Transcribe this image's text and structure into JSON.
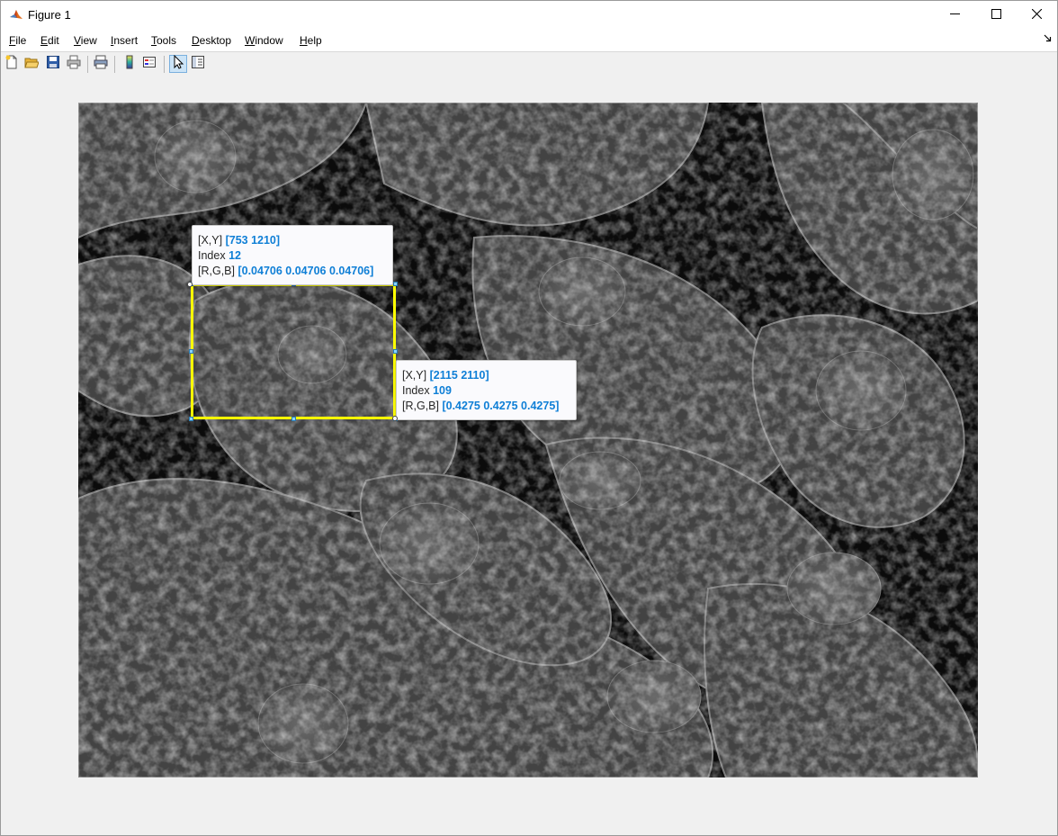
{
  "window": {
    "title": "Figure 1",
    "controls": {
      "minimize": "minimize-icon",
      "maximize": "maximize-icon",
      "close": "close-icon"
    }
  },
  "menu": {
    "items": [
      {
        "label": "File",
        "underline": "F",
        "rest": "ile"
      },
      {
        "label": "Edit",
        "underline": "E",
        "rest": "dit"
      },
      {
        "label": "View",
        "underline": "V",
        "rest": "iew"
      },
      {
        "label": "Insert",
        "underline": "I",
        "rest": "nsert"
      },
      {
        "label": "Tools",
        "underline": "T",
        "rest": "ools"
      },
      {
        "label": "Desktop",
        "underline": "D",
        "rest": "esktop"
      },
      {
        "label": "Window",
        "underline": "W",
        "rest": "indow"
      },
      {
        "label": "Help",
        "underline": "H",
        "rest": "elp"
      }
    ]
  },
  "toolbar": {
    "buttons": [
      "new-figure-icon",
      "open-file-icon",
      "save-icon",
      "print-icon",
      "print-preview-icon",
      "insert-colorbar-icon",
      "insert-legend-icon",
      "edit-plot-pointer-icon",
      "property-inspector-icon"
    ],
    "active": "edit-plot-pointer-icon"
  },
  "image": {
    "description_icon": "microscopy-image"
  },
  "datatips": [
    {
      "xy_label": "[X,Y]",
      "xy_value": "[753 1210]",
      "index_label": "Index",
      "index_value": "12",
      "rgb_label": "[R,G,B]",
      "rgb_value": "[0.04706 0.04706 0.04706]"
    },
    {
      "xy_label": "[X,Y]",
      "xy_value": "[2115 2110]",
      "index_label": "Index",
      "index_value": "109",
      "rgb_label": "[R,G,B]",
      "rgb_value": "[0.4275 0.4275 0.4275]"
    }
  ],
  "roi": {
    "color": "#ffff00",
    "handle_color": "#8ad4ff"
  },
  "colors": {
    "accent_value": "#0f7fd6",
    "figure_bg": "#f0f0f0"
  }
}
